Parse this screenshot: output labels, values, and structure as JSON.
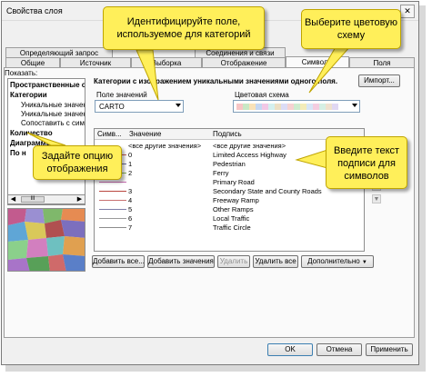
{
  "window": {
    "title": "Свойства слоя",
    "close_label": "✕"
  },
  "tabs_row1": [
    "Определяющий запрос",
    "Соединения и связи"
  ],
  "tabs_row2": [
    "Общие",
    "Источник",
    "Выборка",
    "Отображение",
    "Символы",
    "Поля"
  ],
  "left": {
    "show_label": "Показать:",
    "tree": [
      {
        "label": "Пространственные о",
        "bold": true
      },
      {
        "label": "Категории",
        "bold": true
      },
      {
        "label": "Уникальные значения",
        "bold": false
      },
      {
        "label": "Уникальные значения",
        "bold": false
      },
      {
        "label": "Сопоставить с симв",
        "bold": false
      },
      {
        "label": "Количество",
        "bold": true
      },
      {
        "label": "Диаграммы",
        "bold": true
      },
      {
        "label": "По н",
        "bold": true
      }
    ],
    "scroll_thumb": "III"
  },
  "main": {
    "heading": "Категории с изображением уникальными значениями одного поля.",
    "import_button": "Импорт...",
    "value_field_label": "Поле значений",
    "value_field_value": "CARTO",
    "color_scheme_label": "Цветовая схема",
    "ramp_colors": [
      "#f7c6c6",
      "#c9e8c5",
      "#f9e2b8",
      "#c6d8f2",
      "#f2c8e6",
      "#d4f0ef",
      "#ece0c5",
      "#dcdcf6",
      "#f6d2d2",
      "#cfeccf",
      "#f3ecb9",
      "#d8e6f6",
      "#f4cde0",
      "#d6efe4",
      "#efe1cf",
      "#e1d8f3"
    ]
  },
  "table": {
    "headers": [
      "Симв...",
      "Значение",
      "Подпись"
    ],
    "rows": [
      {
        "value": "<все другие значения>",
        "label": "<все другие значения>",
        "color": ""
      },
      {
        "value": "0",
        "label": "Limited Access Highway",
        "color": "#c55a5a"
      },
      {
        "value": "1",
        "label": "Pedestrian",
        "color": "#6b6b9c"
      },
      {
        "value": "2",
        "label": "Ferry",
        "color": "#8ab45a"
      },
      {
        "value": "",
        "label": "Primary Road",
        "color": "#c86bb0"
      },
      {
        "value": "3",
        "label": "Secondary State and County Roads",
        "color": "#b9473f"
      },
      {
        "value": "4",
        "label": "Freeway Ramp",
        "color": "#c87070"
      },
      {
        "value": "5",
        "label": "Other Ramps",
        "color": "#7e7ea8"
      },
      {
        "value": "6",
        "label": "Local Traffic",
        "color": "#9a9a9a"
      },
      {
        "value": "7",
        "label": "Traffic Circle",
        "color": "#8c8c8c"
      }
    ]
  },
  "buttons": {
    "add_all": "Добавить все...",
    "add_values": "Добавить значения",
    "remove": "Удалить",
    "remove_all": "Удалить все",
    "advanced": "Дополнительно",
    "ok": "OK",
    "cancel": "Отмена",
    "apply": "Применить"
  },
  "callouts": {
    "field": "Идентифицируйте поле, используемое для категорий",
    "color": "Выберите цветовую схему",
    "label": "Введите текст подписи для символов",
    "option": "Задайте опцию отображения"
  }
}
